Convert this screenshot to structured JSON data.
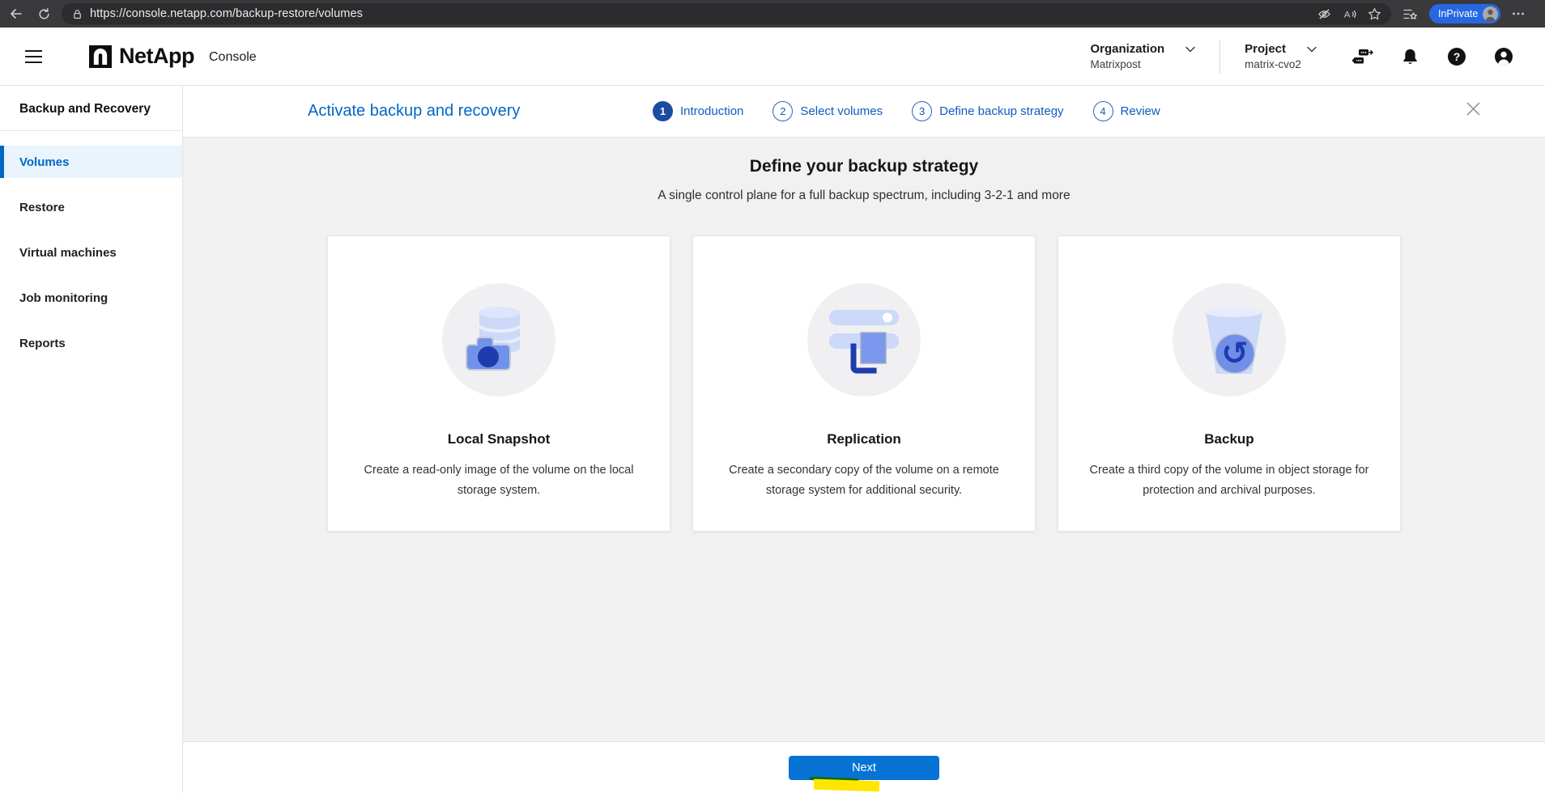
{
  "browser": {
    "url": "https://console.netapp.com/backup-restore/volumes",
    "inprivate_label": "InPrivate"
  },
  "header": {
    "brand": "NetApp",
    "console_label": "Console",
    "organization": {
      "label": "Organization",
      "value": "Matrixpost"
    },
    "project": {
      "label": "Project",
      "value": "matrix-cvo2"
    }
  },
  "sidebar": {
    "title": "Backup and Recovery",
    "items": [
      {
        "label": "Volumes",
        "active": true
      },
      {
        "label": "Restore",
        "active": false
      },
      {
        "label": "Virtual machines",
        "active": false
      },
      {
        "label": "Job monitoring",
        "active": false
      },
      {
        "label": "Reports",
        "active": false
      }
    ]
  },
  "wizard": {
    "title": "Activate backup and recovery",
    "steps": [
      {
        "num": "1",
        "label": "Introduction",
        "state": "current"
      },
      {
        "num": "2",
        "label": "Select volumes",
        "state": "upcoming"
      },
      {
        "num": "3",
        "label": "Define backup strategy",
        "state": "upcoming"
      },
      {
        "num": "4",
        "label": "Review",
        "state": "upcoming"
      }
    ]
  },
  "content": {
    "heading": "Define your backup strategy",
    "subheading": "A single control plane for a full backup spectrum, including 3-2-1 and more",
    "cards": [
      {
        "title": "Local Snapshot",
        "description": "Create a read-only image of the volume on the local storage system.",
        "icon": "local-snapshot-icon"
      },
      {
        "title": "Replication",
        "description": "Create a secondary copy of the volume on a remote storage system for additional security.",
        "icon": "replication-icon"
      },
      {
        "title": "Backup",
        "description": "Create a third copy of the volume in object storage for protection and archival purposes.",
        "icon": "backup-bucket-icon"
      }
    ]
  },
  "footer": {
    "next_label": "Next"
  },
  "colors": {
    "accent_blue": "#0067c5",
    "step_active_fill": "#1b4ca0",
    "next_button_blue": "#0673d4",
    "highlight_yellow": "#ffe600",
    "highlight_green": "#0e6b00",
    "inprivate_badge_blue": "#2767e3",
    "icon_light_blue": "#ccd9f8",
    "icon_medium_blue": "#7092e9",
    "icon_dark_blue": "#1e3cae",
    "main_background": "#f1f1f2"
  },
  "icons": {
    "browser": [
      "back-icon",
      "refresh-icon",
      "lock-icon",
      "tracking-prevention-icon",
      "read-aloud-icon",
      "favorite-star-icon",
      "favorites-bar-icon",
      "more-options-icon"
    ],
    "header": [
      "menu-icon",
      "netapp-logo",
      "chevron-down-icon",
      "connector-icon",
      "bell-icon",
      "help-icon",
      "account-icon"
    ],
    "wizard": [
      "close-icon"
    ],
    "cards": [
      "local-snapshot-icon",
      "replication-icon",
      "backup-bucket-icon"
    ]
  }
}
